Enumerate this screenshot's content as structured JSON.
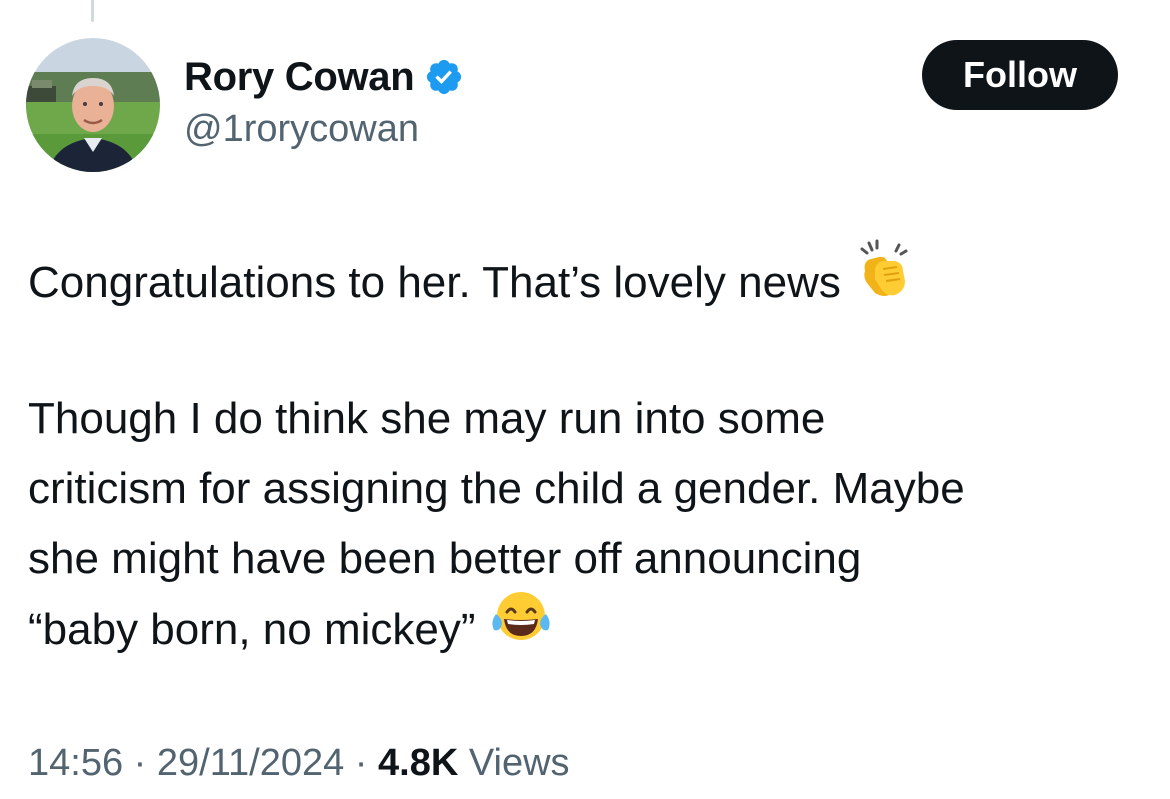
{
  "author": {
    "display_name": "Rory Cowan",
    "handle": "@1rorycowan",
    "verified_icon": "verified-badge-icon",
    "verified_color": "#1d9bf0"
  },
  "follow_button": {
    "label": "Follow"
  },
  "tweet": {
    "paragraph1": {
      "text": "Congratulations to her. That’s lovely news",
      "emoji": "clapping-hands-icon"
    },
    "paragraph2": {
      "lines": [
        "Though I do think she may run into some",
        "criticism for assigning the child a gender. Maybe",
        "she might have been better off announcing",
        "“baby born, no mickey”"
      ],
      "emoji": "face-with-tears-of-joy-icon"
    }
  },
  "meta": {
    "time": "14:56",
    "sep1": " · ",
    "date": "29/11/2024",
    "sep2": " · ",
    "views_count": "4.8K",
    "views_label": " Views"
  },
  "colors": {
    "text": "#0f1419",
    "secondary": "#536471",
    "button_bg": "#0f1419",
    "button_text": "#ffffff"
  }
}
